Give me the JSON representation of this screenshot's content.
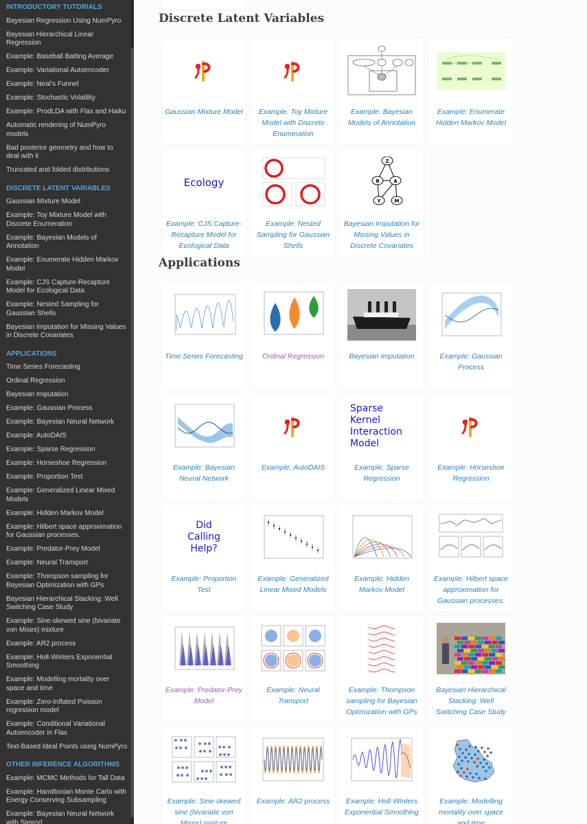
{
  "sidebar": {
    "sections": [
      {
        "caption": "INTRODUCTORY TUTORIALS",
        "items": [
          "Bayesian Regression Using NumPyro",
          "Bayesian Hierarchical Linear Regression",
          "Example: Baseball Batting Average",
          "Example: Variational Autoencoder",
          "Example: Neal’s Funnel",
          "Example: Stochastic Volatility",
          "Example: ProdLDA with Flax and Haiku",
          "Automatic rendering of NumPyro models",
          "Bad posterior geometry and how to deal with it",
          "Truncated and folded distributions"
        ]
      },
      {
        "caption": "DISCRETE LATENT VARIABLES",
        "items": [
          "Gaussian Mixture Model",
          "Example: Toy Mixture Model with Discrete Enumeration",
          "Example: Bayesian Models of Annotation",
          "Example: Enumerate Hidden Markov Model",
          "Example: CJS Capture-Recapture Model for Ecological Data",
          "Example: Nested Sampling for Gaussian Shells",
          "Bayesian Imputation for Missing Values in Discrete Covariates"
        ]
      },
      {
        "caption": "APPLICATIONS",
        "items": [
          "Time Series Forecasting",
          "Ordinal Regression",
          "Bayesian Imputation",
          "Example: Gaussian Process",
          "Example: Bayesian Neural Network",
          "Example: AutoDAIS",
          "Example: Sparse Regression",
          "Example: Horseshoe Regression",
          "Example: Proportion Test",
          "Example: Generalized Linear Mixed Models",
          "Example: Hidden Markov Model",
          "Example: Hilbert space approximation for Gaussian processes.",
          "Example: Predator-Prey Model",
          "Example: Neural Transport",
          "Example: Thompson sampling for Bayesian Optimization with GPs",
          "Bayesian Hierarchical Stacking: Well Switching Case Study",
          "Example: Sine-skewed sine (bivariate von Mises) mixture",
          "Example: AR2 process",
          "Example: Holt-Winters Exponential Smoothing",
          "Example: Modelling mortality over space and time",
          "Example: Zero-Inflated Poisson regression model",
          "Example: Conditional Variational Autoencoder in Flax",
          "Text-Based Ideal Points using NumPyro"
        ]
      },
      {
        "caption": "OTHER INFERENCE ALGORITHMS",
        "items": [
          "Example: MCMC Methods for Tall Data",
          "Example: Hamiltonian Monte Carlo with Energy Conserving Subsampling",
          "Example: Bayesian Neural Network with SteinVI"
        ]
      }
    ]
  },
  "main": {
    "headings": [
      "Discrete Latent Variables",
      "Applications"
    ],
    "discrete_cards": [
      {
        "caption": "Gaussian Mixture Model",
        "thumb": "numpyro-logo-icon"
      },
      {
        "caption": "Example: Toy Mixture Model with Discrete Enumeration",
        "thumb": "numpyro-logo-icon"
      },
      {
        "caption": "Example: Bayesian Models of Annotation",
        "thumb": "annotation-graph-icon"
      },
      {
        "caption": "Example: Enumerate Hidden Markov Model",
        "thumb": "hmm-graph-icon"
      },
      {
        "caption": "Example: CJS Capture-Recapture Model for Ecological Data",
        "thumb": "text-thumb",
        "thumb_text": "Ecology"
      },
      {
        "caption": "Example: Nested Sampling for Gaussian Shells",
        "thumb": "shells-plot-icon"
      },
      {
        "caption": "Bayesian Imputation for Missing Values in Discrete Covariates",
        "thumb": "dag-icon",
        "nodes": [
          "Z",
          "B",
          "A",
          "Y",
          "M"
        ]
      }
    ],
    "app_cards": [
      {
        "caption": "Time Series Forecasting",
        "thumb": "timeseries-plot-icon"
      },
      {
        "caption": "Ordinal Regression",
        "thumb": "violin-plot-icon",
        "visited": true
      },
      {
        "caption": "Bayesian Imputation",
        "thumb": "ship-photo-icon"
      },
      {
        "caption": "Example: Gaussian Process",
        "thumb": "gp-plot-icon"
      },
      {
        "caption": "Example: Bayesian Neural Network",
        "thumb": "bnn-plot-icon"
      },
      {
        "caption": "Example: AutoDAIS",
        "thumb": "numpyro-logo-icon"
      },
      {
        "caption": "Example: Sparse Regression",
        "thumb": "text-thumb",
        "thumb_text": "Sparse Kernel Interaction Model"
      },
      {
        "caption": "Example: Horseshoe Regression",
        "thumb": "numpyro-logo-icon"
      },
      {
        "caption": "Example: Proportion Test",
        "thumb": "text-thumb",
        "thumb_text": "Did Calling Help?"
      },
      {
        "caption": "Example: Generalized Linear Mixed Models",
        "thumb": "glmm-plot-icon"
      },
      {
        "caption": "Example: Hidden Markov Model",
        "thumb": "hmm-plot-icon"
      },
      {
        "caption": "Example: Hilbert space approximation for Gaussian processes.",
        "thumb": "hsgp-plot-icon"
      },
      {
        "caption": "Example: Predator-Prey Model",
        "thumb": "predator-prey-plot-icon",
        "visited": true
      },
      {
        "caption": "Example: Neural Transport",
        "thumb": "neutra-plot-icon"
      },
      {
        "caption": "Example: Thompson sampling for Bayesian Optimization with GPs",
        "thumb": "thompson-plot-icon"
      },
      {
        "caption": "Bayesian Hierarchical Stacking: Well Switching Case Study",
        "thumb": "brick-wall-photo-icon"
      },
      {
        "caption": "Example: Sine-skewed sine (bivariate von Mises) mixture",
        "thumb": "sine-skewed-plot-icon"
      },
      {
        "caption": "Example: AR2 process",
        "thumb": "ar2-plot-icon"
      },
      {
        "caption": "Example: Holt-Winters Exponential Smoothing",
        "thumb": "holt-winters-plot-icon"
      },
      {
        "caption": "Example: Modelling mortality over space and time",
        "thumb": "mortality-map-icon"
      }
    ]
  }
}
